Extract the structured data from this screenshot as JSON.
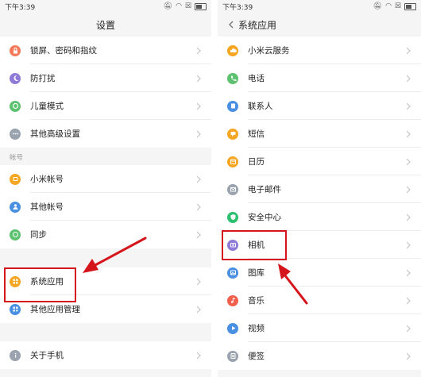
{
  "left": {
    "status": {
      "time": "下午3:39"
    },
    "title": "设置",
    "group1": [
      {
        "label": "锁屏、密码和指纹",
        "icon": "lock-icon",
        "color": "#f47a5b"
      },
      {
        "label": "防打扰",
        "icon": "moon-icon",
        "color": "#8f7ad8"
      },
      {
        "label": "儿童模式",
        "icon": "child-icon",
        "color": "#5cc270"
      },
      {
        "label": "其他高级设置",
        "icon": "more-icon",
        "color": "#9aa3ae"
      }
    ],
    "section_account": "帐号",
    "group2": [
      {
        "label": "小米帐号",
        "icon": "mi-account-icon",
        "color": "#f5a623"
      },
      {
        "label": "其他帐号",
        "icon": "person-icon",
        "color": "#4a90e2"
      },
      {
        "label": "同步",
        "icon": "sync-icon",
        "color": "#5cc270"
      }
    ],
    "group3": [
      {
        "label": "系统应用",
        "icon": "apps-grid-icon",
        "color": "#f5a623"
      },
      {
        "label": "其他应用管理",
        "icon": "app-manage-icon",
        "color": "#4a90e2"
      }
    ],
    "group4": [
      {
        "label": "关于手机",
        "icon": "info-icon",
        "color": "#9aa3ae"
      }
    ]
  },
  "right": {
    "status": {
      "time": "下午3:39"
    },
    "title": "系统应用",
    "items": [
      {
        "label": "小米云服务",
        "icon": "cloud-icon",
        "color": "#f5a623"
      },
      {
        "label": "电话",
        "icon": "phone-icon",
        "color": "#5cc270"
      },
      {
        "label": "联系人",
        "icon": "contacts-icon",
        "color": "#4a90e2"
      },
      {
        "label": "短信",
        "icon": "message-icon",
        "color": "#f5a623"
      },
      {
        "label": "日历",
        "icon": "calendar-icon",
        "color": "#f5a623"
      },
      {
        "label": "电子邮件",
        "icon": "mail-icon",
        "color": "#9aa3ae"
      },
      {
        "label": "安全中心",
        "icon": "shield-icon",
        "color": "#2fbf71"
      },
      {
        "label": "相机",
        "icon": "camera-icon",
        "color": "#8f7ad8"
      },
      {
        "label": "图库",
        "icon": "gallery-icon",
        "color": "#4a90e2"
      },
      {
        "label": "音乐",
        "icon": "music-icon",
        "color": "#f0604d"
      },
      {
        "label": "视频",
        "icon": "video-icon",
        "color": "#4a90e2"
      },
      {
        "label": "便签",
        "icon": "note-icon",
        "color": "#9aa3ae"
      }
    ]
  },
  "annotation_color": "#d4161c"
}
